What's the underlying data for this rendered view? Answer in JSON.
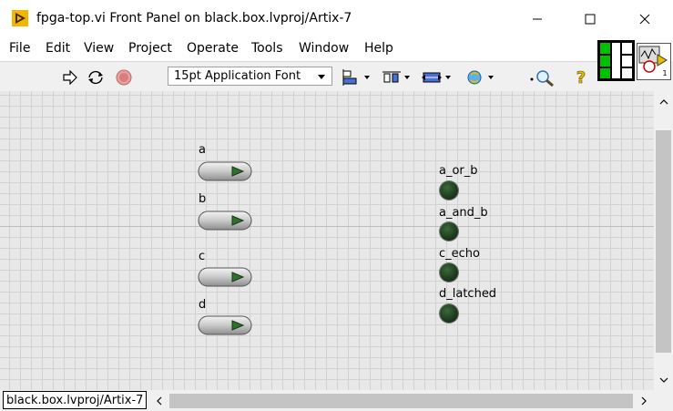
{
  "window": {
    "title": "fpga-top.vi Front Panel on black.box.lvproj/Artix-7",
    "minimize_glyph": "—",
    "maximize_glyph": "☐",
    "close_glyph": "✕"
  },
  "menu": [
    "File",
    "Edit",
    "View",
    "Project",
    "Operate",
    "Tools",
    "Window",
    "Help"
  ],
  "toolbar": {
    "font_select": "15pt Application Font",
    "icons": [
      "run-arrow-icon",
      "run-continuously-icon",
      "abort-stop-icon",
      "align-objects-icon",
      "distribute-objects-icon",
      "resize-objects-icon",
      "reorder-icon",
      "search-icon",
      "help-icon"
    ]
  },
  "controls": [
    {
      "label": "a"
    },
    {
      "label": "b"
    },
    {
      "label": "c"
    },
    {
      "label": "d"
    }
  ],
  "indicators": [
    {
      "label": "a_or_b"
    },
    {
      "label": "a_and_b"
    },
    {
      "label": "c_echo"
    },
    {
      "label": "d_latched"
    }
  ],
  "status": {
    "context": "black.box.lvproj/Artix-7"
  },
  "vi_icon": {
    "text": "1"
  },
  "colors": {
    "led_off": "#1e3d1e",
    "title_icon": "#f5b400",
    "accent_green": "#00c000"
  }
}
